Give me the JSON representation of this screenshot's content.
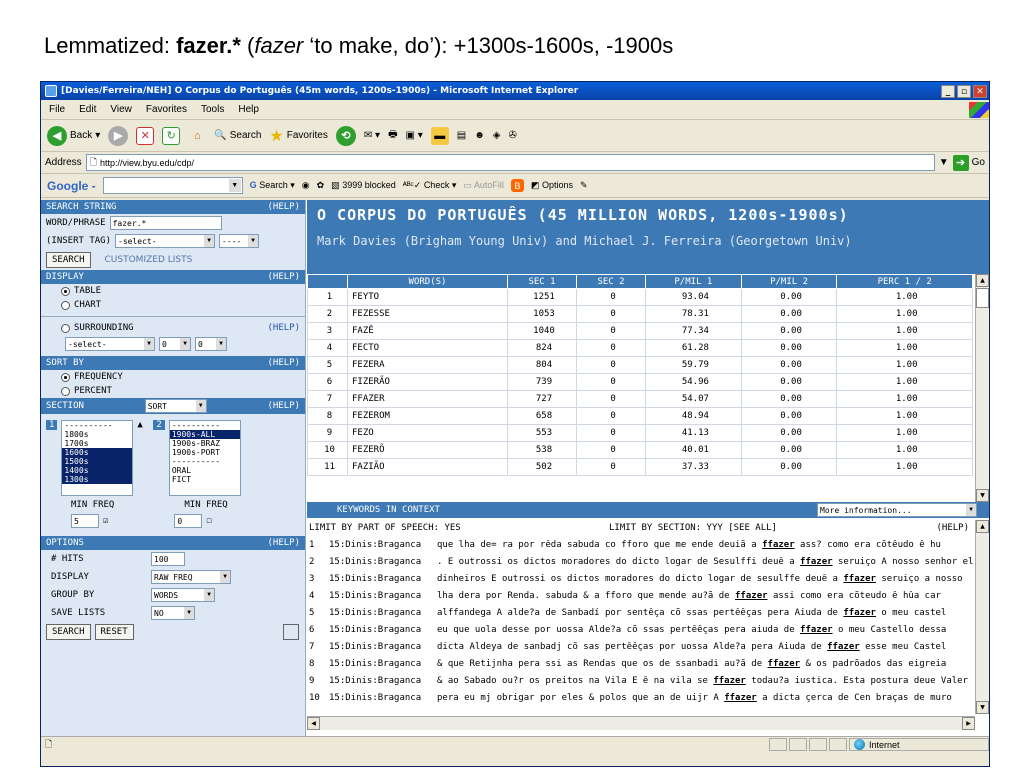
{
  "slide": {
    "title_prefix": "Lemmatized: ",
    "title_bold": "fazer.*",
    "title_open": " (",
    "title_italic": "fazer",
    "title_rest": " ‘to make, do’): +1300s-1600s, -1900s"
  },
  "window": {
    "title": "[Davies/Ferreira/NEH] O Corpus do Português (45m words, 1200s-1900s) - Microsoft Internet Explorer",
    "menu": [
      "File",
      "Edit",
      "View",
      "Favorites",
      "Tools",
      "Help"
    ],
    "toolbar": {
      "back": "Back",
      "search": "Search",
      "favorites": "Favorites"
    },
    "address_label": "Address",
    "url": "http://view.byu.edu/cdp/",
    "go_label": "Go",
    "google": {
      "logo": "Google -",
      "search": "Search",
      "blocked": "3999 blocked",
      "check": "Check",
      "autofill": "AutoFill",
      "options": "Options"
    }
  },
  "left": {
    "search_string": {
      "header": "SEARCH STRING",
      "help": "(HELP)"
    },
    "word_phrase_label": "WORD/PHRASE",
    "word_phrase_value": "fazer.*",
    "insert_tag_label": "(INSERT TAG)",
    "insert_tag_value": "-select-",
    "insert_tag_extra": "----",
    "search_button": "SEARCH",
    "customized_lists": "CUSTOMIZED LISTS",
    "display": {
      "header": "DISPLAY",
      "help": "(HELP)",
      "table": "TABLE",
      "chart": "CHART",
      "surrounding": "SURROUNDING",
      "surrounding_help": "(HELP)",
      "surr_select": "-select-",
      "surr_a": "0",
      "surr_b": "0"
    },
    "sort_by": {
      "header": "SORT BY",
      "help": "(HELP)",
      "frequency": "FREQUENCY",
      "percent": "PERCENT"
    },
    "section": {
      "header": "SECTION",
      "sort": "SORT",
      "help": "(HELP)",
      "label1": "1",
      "label2": "2",
      "list1": [
        "----------",
        "1800s",
        "1700s",
        "1600s",
        "1500s",
        "1400s",
        "1300s"
      ],
      "list1_hl": [
        false,
        false,
        false,
        true,
        true,
        true,
        true
      ],
      "list2": [
        "----------",
        "1900s-ALL",
        "1900s-BRAZ",
        "1900s-PORT",
        "----------",
        "ORAL",
        "FICT"
      ],
      "list2_hl": [
        false,
        true,
        false,
        false,
        false,
        false,
        false
      ],
      "min_freq": "MIN FREQ",
      "min1": "5",
      "min2": "0"
    },
    "options": {
      "header": "OPTIONS",
      "help": "(HELP)",
      "hits_label": "# HITS",
      "hits_value": "100",
      "display_label": "DISPLAY",
      "display_value": "RAW FREQ",
      "group_label": "GROUP BY",
      "group_value": "WORDS",
      "save_label": "SAVE LISTS",
      "save_value": "NO"
    },
    "search2": "SEARCH",
    "reset": "RESET"
  },
  "banner": {
    "title": "O CORPUS DO PORTUGUÊS (45 MILLION WORDS, 1200s-1900s)",
    "subtitle": "Mark Davies (Brigham Young Univ) and Michael J. Ferreira (Georgetown Univ)"
  },
  "results": {
    "columns": [
      "",
      "WORD(S)",
      "SEC 1",
      "SEC 2",
      "P/MIL 1",
      "P/MIL 2",
      "PERC 1 / 2"
    ],
    "rows": [
      [
        "1",
        "FEYTO",
        "1251",
        "0",
        "93.04",
        "0.00",
        "1.00"
      ],
      [
        "2",
        "FEZESSE",
        "1053",
        "0",
        "78.31",
        "0.00",
        "1.00"
      ],
      [
        "3",
        "FAZÊ",
        "1040",
        "0",
        "77.34",
        "0.00",
        "1.00"
      ],
      [
        "4",
        "FECTO",
        "824",
        "0",
        "61.28",
        "0.00",
        "1.00"
      ],
      [
        "5",
        "FEZERA",
        "804",
        "0",
        "59.79",
        "0.00",
        "1.00"
      ],
      [
        "6",
        "FIZERÃO",
        "739",
        "0",
        "54.96",
        "0.00",
        "1.00"
      ],
      [
        "7",
        "FFAZER",
        "727",
        "0",
        "54.07",
        "0.00",
        "1.00"
      ],
      [
        "8",
        "FEZEROM",
        "658",
        "0",
        "48.94",
        "0.00",
        "1.00"
      ],
      [
        "9",
        "FEZO",
        "553",
        "0",
        "41.13",
        "0.00",
        "1.00"
      ],
      [
        "10",
        "FEZERÕ",
        "538",
        "0",
        "40.01",
        "0.00",
        "1.00"
      ],
      [
        "11",
        "FAZIÃO",
        "502",
        "0",
        "37.33",
        "0.00",
        "1.00"
      ]
    ]
  },
  "kwic": {
    "header": "KEYWORDS IN CONTEXT",
    "more_info": "More information...",
    "limit_pos": "LIMIT BY PART OF SPEECH: YES",
    "limit_section": "LIMIT BY SECTION: YYY [SEE ALL]",
    "help": "(HELP)",
    "rows": [
      {
        "n": "1",
        "src": "15:Dinis:Braganca",
        "pre": "que lha de= ra por rêda sabuda co fforo que me ende deuiã a ",
        "kw": "ffazer",
        "post": " ass? como era cõtêudo ê hu"
      },
      {
        "n": "2",
        "src": "15:Dinis:Braganca",
        "pre": ". E outrossi os dictos moradores do dicto logar de Sesulffi deuê a ",
        "kw": "ffazer",
        "post": " seruiço A nosso senhor el"
      },
      {
        "n": "3",
        "src": "15:Dinis:Braganca",
        "pre": "dinheiros E outrossi os dictos moradores do dicto logar de sesulffe deuê a ",
        "kw": "ffazer",
        "post": " seruiço a nosso"
      },
      {
        "n": "4",
        "src": "15:Dinis:Braganca",
        "pre": "lha dera por Renda. sabuda & a fforo que mende au?ã de ",
        "kw": "ffazer",
        "post": " assi como era cõteudo ê hûa car"
      },
      {
        "n": "5",
        "src": "15:Dinis:Braganca",
        "pre": "alffandega A alde?a de Sanbadí por sentêça cõ ssas pertêêças pera Aiuda de ",
        "kw": "ffazer",
        "post": " o meu castel"
      },
      {
        "n": "6",
        "src": "15:Dinis:Braganca",
        "pre": "eu que uola desse por uossa Alde?a cõ ssas pertêêças pera aiuda de ",
        "kw": "ffazer",
        "post": " o meu Castello dessa"
      },
      {
        "n": "7",
        "src": "15:Dinis:Braganca",
        "pre": "dicta Aldeya de sanbadj cõ sas pertêêças por uossa Alde?a pera Aiuda de ",
        "kw": "ffazer",
        "post": " esse meu Castel"
      },
      {
        "n": "8",
        "src": "15:Dinis:Braganca",
        "pre": "& que Retijnha pera ssi as Rendas que os de ssanbadi au?ã de ",
        "kw": "ffazer",
        "post": " & os padrõados das eigreia"
      },
      {
        "n": "9",
        "src": "15:Dinis:Braganca",
        "pre": "& ao Sabado ou?r os preitos na Vila E ê na vila se ",
        "kw": "ffazer",
        "post": " todau?a iustica. Esta postura deue Valer"
      },
      {
        "n": "10",
        "src": "15:Dinis:Braganca",
        "pre": "pera eu mj obrigar por eles & polos que an de uijr A ",
        "kw": "ffazer",
        "post": " a dicta çerca de Cen braças de muro"
      }
    ]
  },
  "status": {
    "zone": "Internet"
  }
}
